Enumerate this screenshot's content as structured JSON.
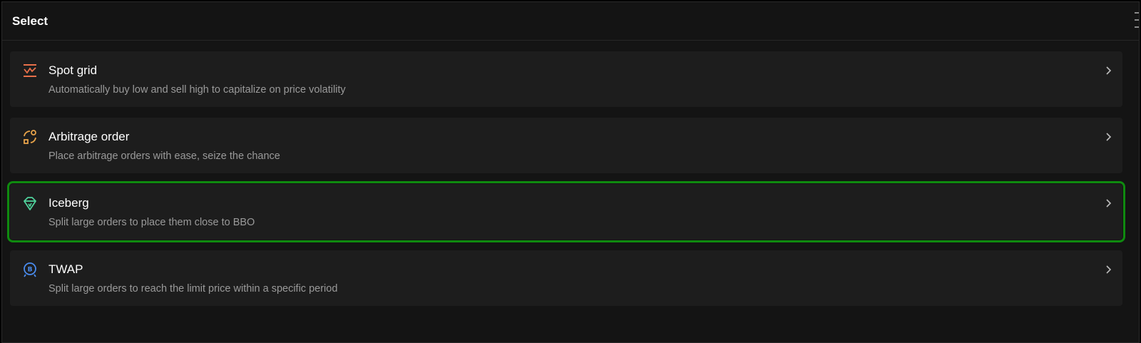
{
  "header": {
    "title": "Select"
  },
  "options": [
    {
      "title": "Spot grid",
      "description": "Automatically buy low and sell high to capitalize on price volatility",
      "icon": "spot-grid-icon",
      "icon_color": "#e8704a"
    },
    {
      "title": "Arbitrage order",
      "description": "Place arbitrage orders with ease, seize the chance",
      "icon": "arbitrage-icon",
      "icon_color": "#e8a34a"
    },
    {
      "title": "Iceberg",
      "description": "Split large orders to place them close to BBO",
      "icon": "iceberg-icon",
      "icon_color": "#4fd19b"
    },
    {
      "title": "TWAP",
      "description": "Split large orders to reach the limit price within a specific period",
      "icon": "twap-icon",
      "icon_color": "#4a8cf0"
    }
  ],
  "colors": {
    "background": "#141414",
    "card": "#1d1d1d",
    "selection_outline": "#0f8a0f"
  }
}
